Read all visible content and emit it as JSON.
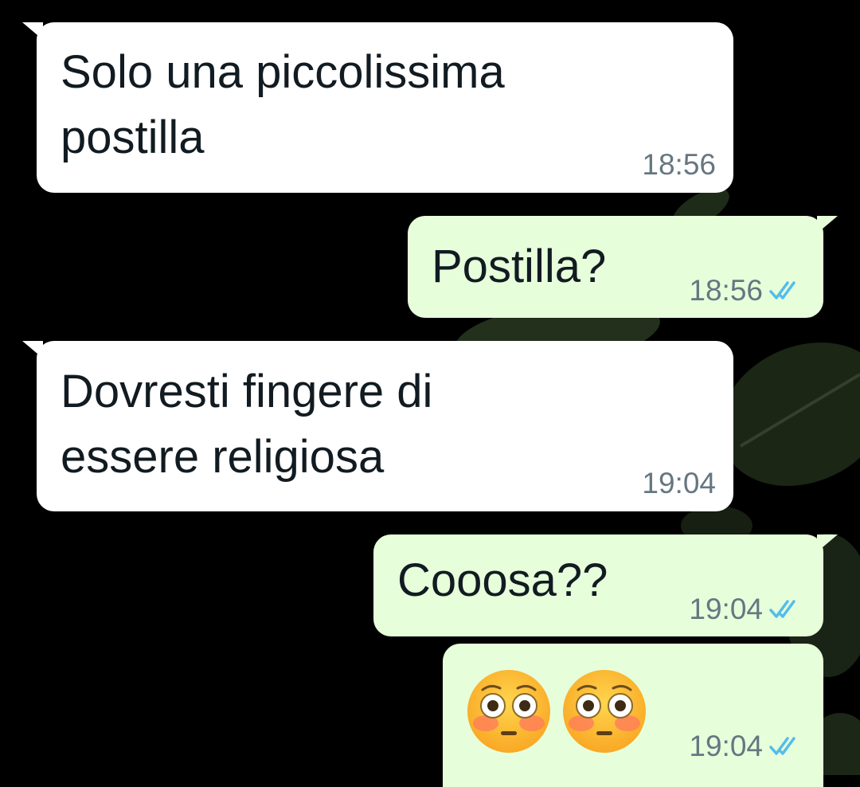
{
  "messages": [
    {
      "direction": "incoming",
      "text": "Solo una piccolissima\npostilla",
      "time": "18:56"
    },
    {
      "direction": "outgoing",
      "text": "Postilla?",
      "time": "18:56",
      "status": "read"
    },
    {
      "direction": "incoming",
      "text": "Dovresti fingere di\nessere religiosa",
      "time": "19:04"
    },
    {
      "direction": "outgoing",
      "text": "Cooosa??",
      "time": "19:04",
      "status": "read"
    },
    {
      "direction": "outgoing",
      "emoji": [
        "flushed-face",
        "flushed-face"
      ],
      "time": "19:04",
      "status": "read"
    }
  ],
  "colors": {
    "background": "#000000",
    "incoming_bubble": "#ffffff",
    "outgoing_bubble": "#e7fedb",
    "text": "#111b21",
    "meta_text": "#667781",
    "read_ticks": "#53bdeb"
  }
}
